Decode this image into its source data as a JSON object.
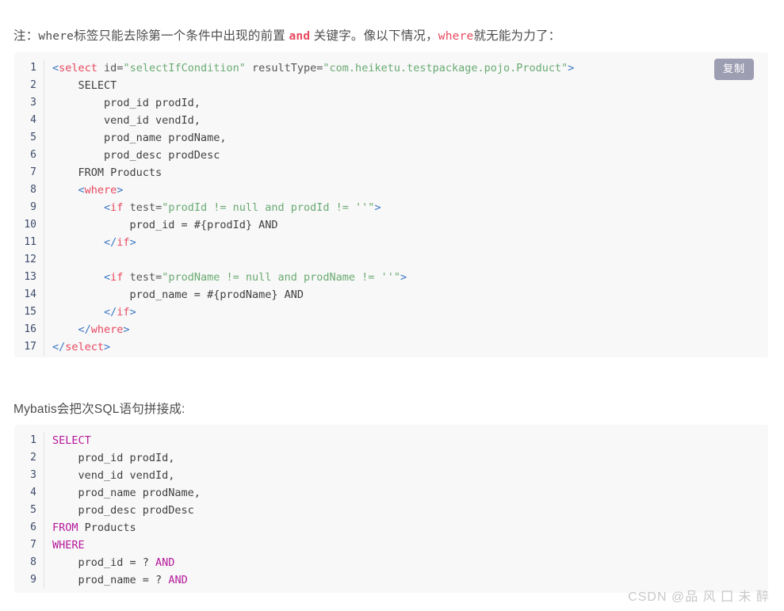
{
  "note_paragraph": {
    "prefix": "注：",
    "code_where_1": "where",
    "text_1": "标签只能去除第一个条件中出现的前置 ",
    "code_and": "and",
    "text_2": " 关键字。像以下情况，",
    "code_where_2": "where",
    "text_3": "就无能为力了："
  },
  "mid_paragraph": {
    "text": "Mybatis会把次SQL语句拼接成:"
  },
  "copy_button": {
    "label": "复制"
  },
  "watermark": {
    "text": "CSDN @品 风 囗 未 醉"
  },
  "codeblock1": {
    "language": "xml",
    "line_numbers": [
      "1",
      "2",
      "3",
      "4",
      "5",
      "6",
      "7",
      "8",
      "9",
      "10",
      "11",
      "12",
      "13",
      "14",
      "15",
      "16",
      "17"
    ],
    "lines": [
      [
        {
          "t": "<",
          "c": "t-punct"
        },
        {
          "t": "select",
          "c": "t-tag"
        },
        {
          "t": " id=",
          "c": "t-attr"
        },
        {
          "t": "\"selectIfCondition\"",
          "c": "t-string"
        },
        {
          "t": " resultType=",
          "c": "t-attr"
        },
        {
          "t": "\"com.heiketu.testpackage.pojo.Product\"",
          "c": "t-string"
        },
        {
          "t": ">",
          "c": "t-punct"
        }
      ],
      [
        {
          "t": "    SELECT",
          "c": "t-plain"
        }
      ],
      [
        {
          "t": "        prod_id prodId,",
          "c": "t-plain"
        }
      ],
      [
        {
          "t": "        vend_id vendId,",
          "c": "t-plain"
        }
      ],
      [
        {
          "t": "        prod_name prodName,",
          "c": "t-plain"
        }
      ],
      [
        {
          "t": "        prod_desc prodDesc",
          "c": "t-plain"
        }
      ],
      [
        {
          "t": "    FROM Products",
          "c": "t-plain"
        }
      ],
      [
        {
          "t": "    ",
          "c": "t-plain"
        },
        {
          "t": "<",
          "c": "t-punct"
        },
        {
          "t": "where",
          "c": "t-tag"
        },
        {
          "t": ">",
          "c": "t-punct"
        }
      ],
      [
        {
          "t": "        ",
          "c": "t-plain"
        },
        {
          "t": "<",
          "c": "t-punct"
        },
        {
          "t": "if",
          "c": "t-tag"
        },
        {
          "t": " test=",
          "c": "t-attr"
        },
        {
          "t": "\"prodId != null and prodId != ''\"",
          "c": "t-string"
        },
        {
          "t": ">",
          "c": "t-punct"
        }
      ],
      [
        {
          "t": "            prod_id = #{prodId} AND",
          "c": "t-plain"
        }
      ],
      [
        {
          "t": "        ",
          "c": "t-plain"
        },
        {
          "t": "</",
          "c": "t-punct"
        },
        {
          "t": "if",
          "c": "t-tag"
        },
        {
          "t": ">",
          "c": "t-punct"
        }
      ],
      [
        {
          "t": "",
          "c": "t-plain"
        }
      ],
      [
        {
          "t": "        ",
          "c": "t-plain"
        },
        {
          "t": "<",
          "c": "t-punct"
        },
        {
          "t": "if",
          "c": "t-tag"
        },
        {
          "t": " test=",
          "c": "t-attr"
        },
        {
          "t": "\"prodName != null and prodName != ''\"",
          "c": "t-string"
        },
        {
          "t": ">",
          "c": "t-punct"
        }
      ],
      [
        {
          "t": "            prod_name = #{prodName} AND",
          "c": "t-plain"
        }
      ],
      [
        {
          "t": "        ",
          "c": "t-plain"
        },
        {
          "t": "</",
          "c": "t-punct"
        },
        {
          "t": "if",
          "c": "t-tag"
        },
        {
          "t": ">",
          "c": "t-punct"
        }
      ],
      [
        {
          "t": "    ",
          "c": "t-plain"
        },
        {
          "t": "</",
          "c": "t-punct"
        },
        {
          "t": "where",
          "c": "t-tag"
        },
        {
          "t": ">",
          "c": "t-punct"
        }
      ],
      [
        {
          "t": "</",
          "c": "t-punct"
        },
        {
          "t": "select",
          "c": "t-tag"
        },
        {
          "t": ">",
          "c": "t-punct"
        }
      ]
    ]
  },
  "codeblock2": {
    "language": "sql",
    "line_numbers": [
      "1",
      "2",
      "3",
      "4",
      "5",
      "6",
      "7",
      "8",
      "9"
    ],
    "lines": [
      [
        {
          "t": "SELECT",
          "c": "t-kw"
        }
      ],
      [
        {
          "t": "    prod_id prodId,",
          "c": "t-plain"
        }
      ],
      [
        {
          "t": "    vend_id vendId,",
          "c": "t-plain"
        }
      ],
      [
        {
          "t": "    prod_name prodName,",
          "c": "t-plain"
        }
      ],
      [
        {
          "t": "    prod_desc prodDesc",
          "c": "t-plain"
        }
      ],
      [
        {
          "t": "FROM",
          "c": "t-kw"
        },
        {
          "t": " Products",
          "c": "t-plain"
        }
      ],
      [
        {
          "t": "WHERE",
          "c": "t-kw"
        }
      ],
      [
        {
          "t": "    prod_id = ? ",
          "c": "t-plain"
        },
        {
          "t": "AND",
          "c": "t-kw"
        }
      ],
      [
        {
          "t": "    prod_name = ? ",
          "c": "t-plain"
        },
        {
          "t": "AND",
          "c": "t-kw"
        }
      ]
    ]
  }
}
